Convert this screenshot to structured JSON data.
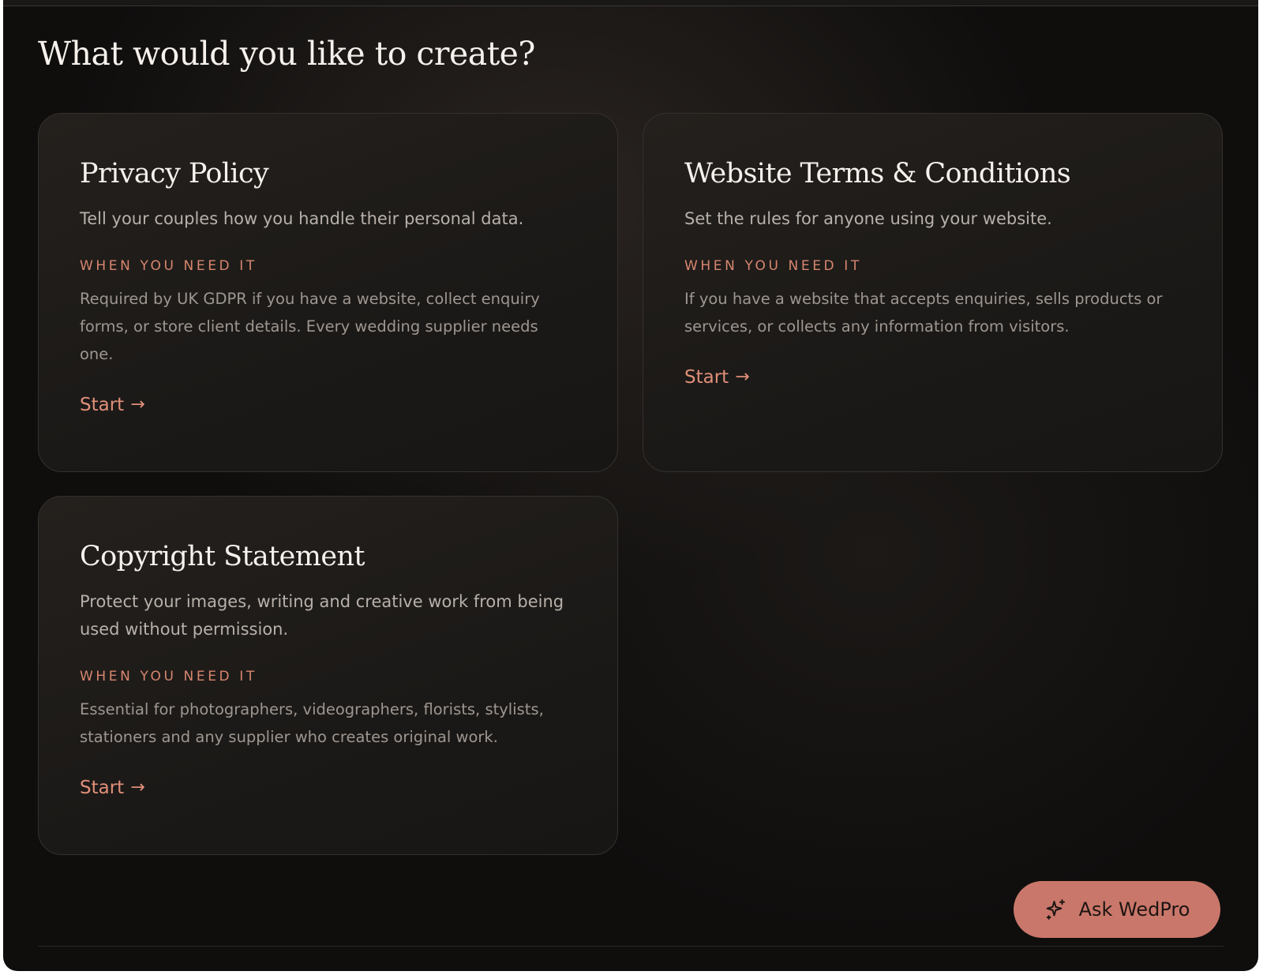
{
  "page": {
    "title": "What would you like to create?"
  },
  "cards": [
    {
      "title": "Privacy Policy",
      "description": "Tell your couples how you handle their personal data.",
      "need_label": "WHEN YOU NEED IT",
      "need_text": "Required by UK GDPR if you have a website, collect enquiry forms, or store client details. Every wedding supplier needs one.",
      "cta_label": "Start",
      "cta_icon": "arrow-right-icon"
    },
    {
      "title": "Website Terms & Conditions",
      "description": "Set the rules for anyone using your website.",
      "need_label": "WHEN YOU NEED IT",
      "need_text": "If you have a website that accepts enquiries, sells products or services, or collects any information from visitors.",
      "cta_label": "Start",
      "cta_icon": "arrow-right-icon"
    },
    {
      "title": "Copyright Statement",
      "description": "Protect your images, writing and creative work from being used without permission.",
      "need_label": "WHEN YOU NEED IT",
      "need_text": "Essential for photographers, videographers, florists, stylists, stationers and any supplier who creates original work.",
      "cta_label": "Start",
      "cta_icon": "arrow-right-icon"
    }
  ],
  "assistant": {
    "label": "Ask WedPro",
    "icon": "sparkle-icon"
  },
  "colors": {
    "background": "#0f0e0d",
    "card_background": "#1e1b19",
    "accent": "#d8866f",
    "button": "#c9776a",
    "heading_text": "#f6f1ec"
  }
}
